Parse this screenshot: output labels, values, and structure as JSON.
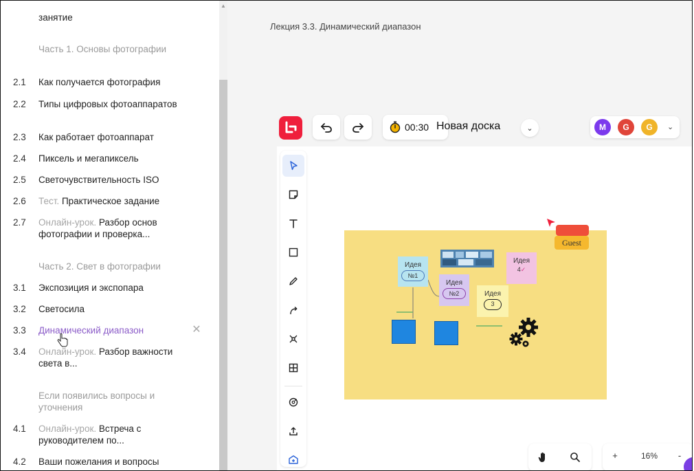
{
  "sidebar": {
    "top_item": {
      "title": "занятие"
    },
    "section1": "Часть 1. Основы фотографии",
    "items1": [
      {
        "num": "2.1",
        "title": "Как получается фотография"
      },
      {
        "num": "2.2",
        "title": "Типы цифровых фотоаппаратов"
      },
      {
        "num": "2.3",
        "title": "Как работает фотоаппарат"
      },
      {
        "num": "2.4",
        "title": "Пиксель и мегапиксель"
      },
      {
        "num": "2.5",
        "title": "Светочувствительность ISO"
      },
      {
        "num": "2.6",
        "prefix": "Тест.",
        "title": "Практическое задание"
      },
      {
        "num": "2.7",
        "prefix": "Онлайн-урок.",
        "title": "Разбор основ фотографии и проверка..."
      }
    ],
    "section2": "Часть 2. Свет в фотографии",
    "items2": [
      {
        "num": "3.1",
        "title": "Экспозиция и экспопара"
      },
      {
        "num": "3.2",
        "title": "Светосила"
      },
      {
        "num": "3.3",
        "title": "Динамический диапазон"
      },
      {
        "num": "3.4",
        "prefix": "Онлайн-урок.",
        "title": "Разбор важности света в..."
      }
    ],
    "section3": "Если появились вопросы и уточнения",
    "items3": [
      {
        "num": "4.1",
        "prefix": "Онлайн-урок.",
        "title": "Встреча с руководителем по..."
      },
      {
        "num": "4.2",
        "title": "Ваши пожелания и вопросы"
      }
    ]
  },
  "main": {
    "lecture_title": "Лекция 3.3. Динамический диапазон"
  },
  "board": {
    "timer": "00:30",
    "name": "Новая доска",
    "avatars": [
      {
        "letter": "M",
        "color": "#7c3aed"
      },
      {
        "letter": "G",
        "color": "#e0453a"
      },
      {
        "letter": "G",
        "color": "#f0b429"
      }
    ],
    "stickies": {
      "s1_title": "Идея",
      "s1_text": "№1",
      "s2_title": "Идея",
      "s2_text": "№2",
      "s3_title": "Идея",
      "s3_text": "3",
      "s4_title": "Идея",
      "s4_text": "4"
    },
    "guest_label": "Guest",
    "zoom": "16%",
    "zoom_minus": "-",
    "zoom_plus": "+"
  },
  "colors": {
    "accent_purple": "#8b5cc8",
    "logo_red": "#ef1f3c",
    "canvas_yellow": "#f7de82",
    "blue_square": "#1f86e0"
  }
}
